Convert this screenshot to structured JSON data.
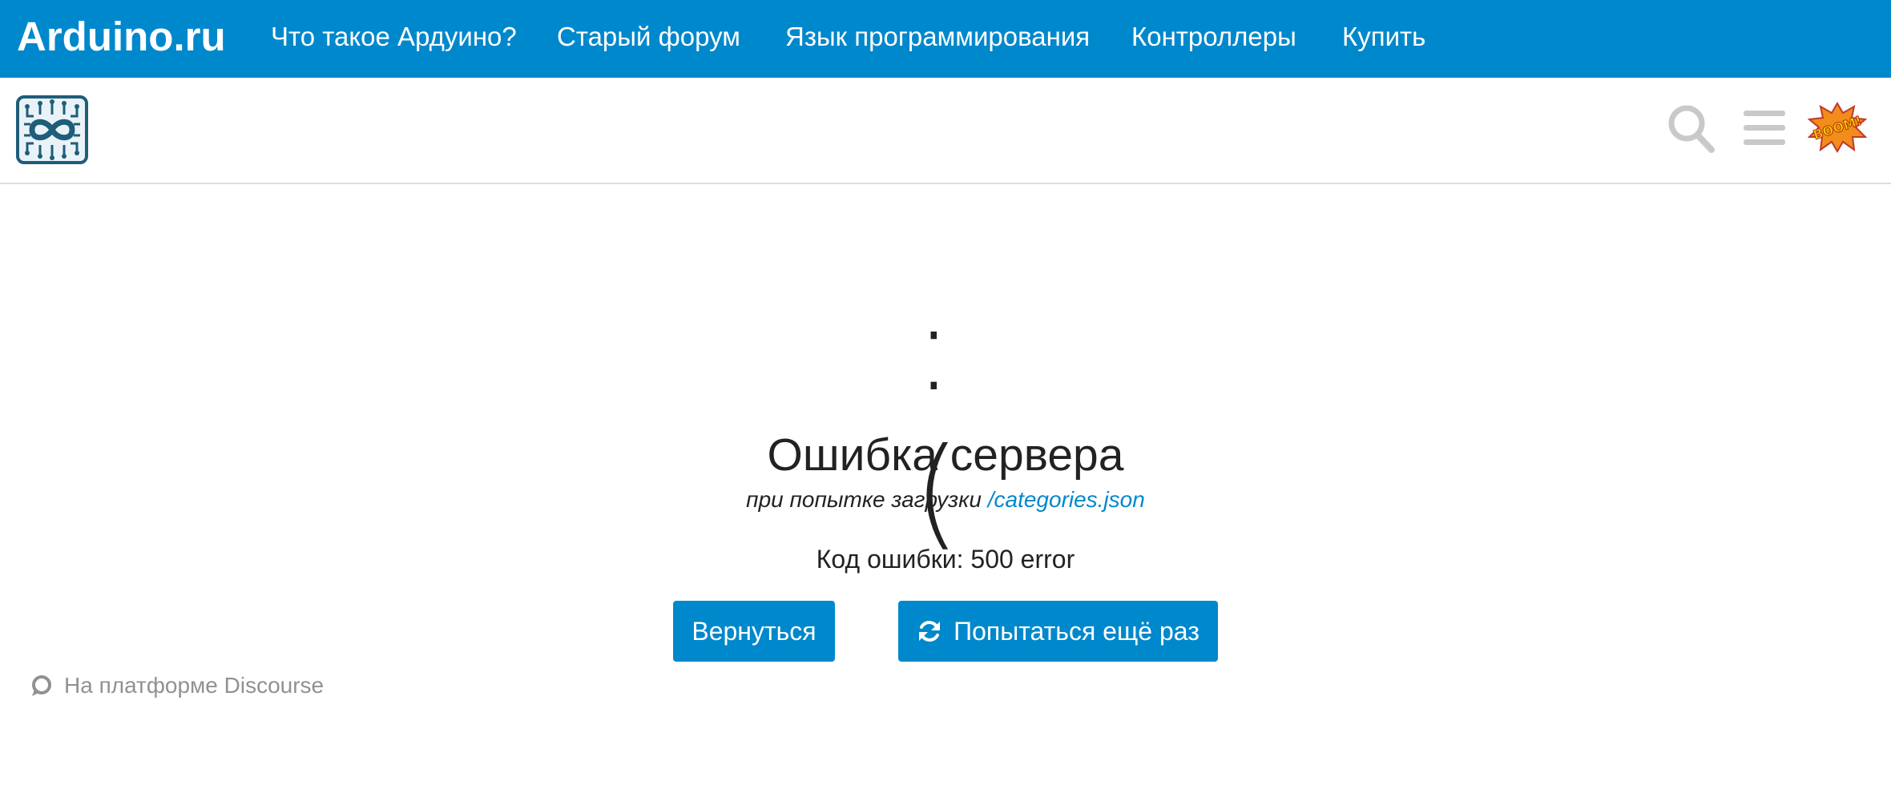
{
  "topbar": {
    "brand": "Arduino.ru",
    "links": [
      "Что такое Ардуино?",
      "Старый форум",
      "Язык программирования",
      "Контроллеры",
      "Купить"
    ],
    "background": "#0088cc"
  },
  "header": {
    "icons": [
      "logo-icon",
      "search-icon",
      "hamburger-menu-icon",
      "avatar"
    ]
  },
  "error": {
    "face": ":(",
    "title": "Ошибка сервера",
    "subtitle_prefix": "при попытке загрузки",
    "subtitle_link": "/categories.json",
    "code": "Код ошибки: 500 error"
  },
  "buttons": {
    "back": "Вернуться",
    "retry": "Попытаться ещё раз"
  },
  "footer": {
    "powered_by": "На платформе Discourse"
  },
  "colors": {
    "accent": "#0088cc",
    "text": "#222222",
    "muted": "#919191"
  }
}
